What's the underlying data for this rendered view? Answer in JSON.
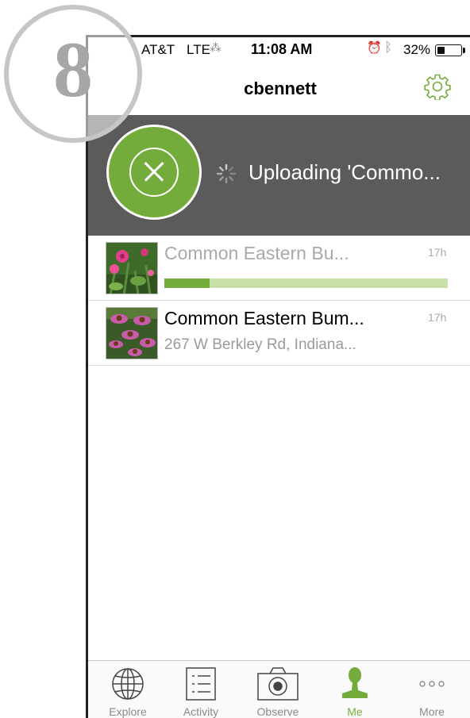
{
  "step_badge": {
    "number": "8"
  },
  "status_bar": {
    "carrier": "AT&T",
    "network": "LTE",
    "time": "11:08 AM",
    "battery_percent": "32%",
    "battery_level": 0.32
  },
  "nav": {
    "title": "cbennett",
    "settings_icon": "gear-icon"
  },
  "upload": {
    "status_text": "Uploading 'Commo...",
    "cancel_icon": "close-circle-icon",
    "accent_color": "#74ac3b",
    "banner_color": "#5b5b5b"
  },
  "observations": [
    {
      "name": "Common Eastern Bu...",
      "time": "17h",
      "uploading": true,
      "progress": 0.16
    },
    {
      "name": "Common Eastern Bum...",
      "time": "17h",
      "location": "267 W Berkley Rd, Indiana..."
    }
  ],
  "tabs": [
    {
      "label": "Explore",
      "icon": "globe-icon"
    },
    {
      "label": "Activity",
      "icon": "list-icon"
    },
    {
      "label": "Observe",
      "icon": "camera-icon"
    },
    {
      "label": "Me",
      "icon": "person-icon",
      "active": true
    },
    {
      "label": "More",
      "icon": "more-dots-icon"
    }
  ]
}
